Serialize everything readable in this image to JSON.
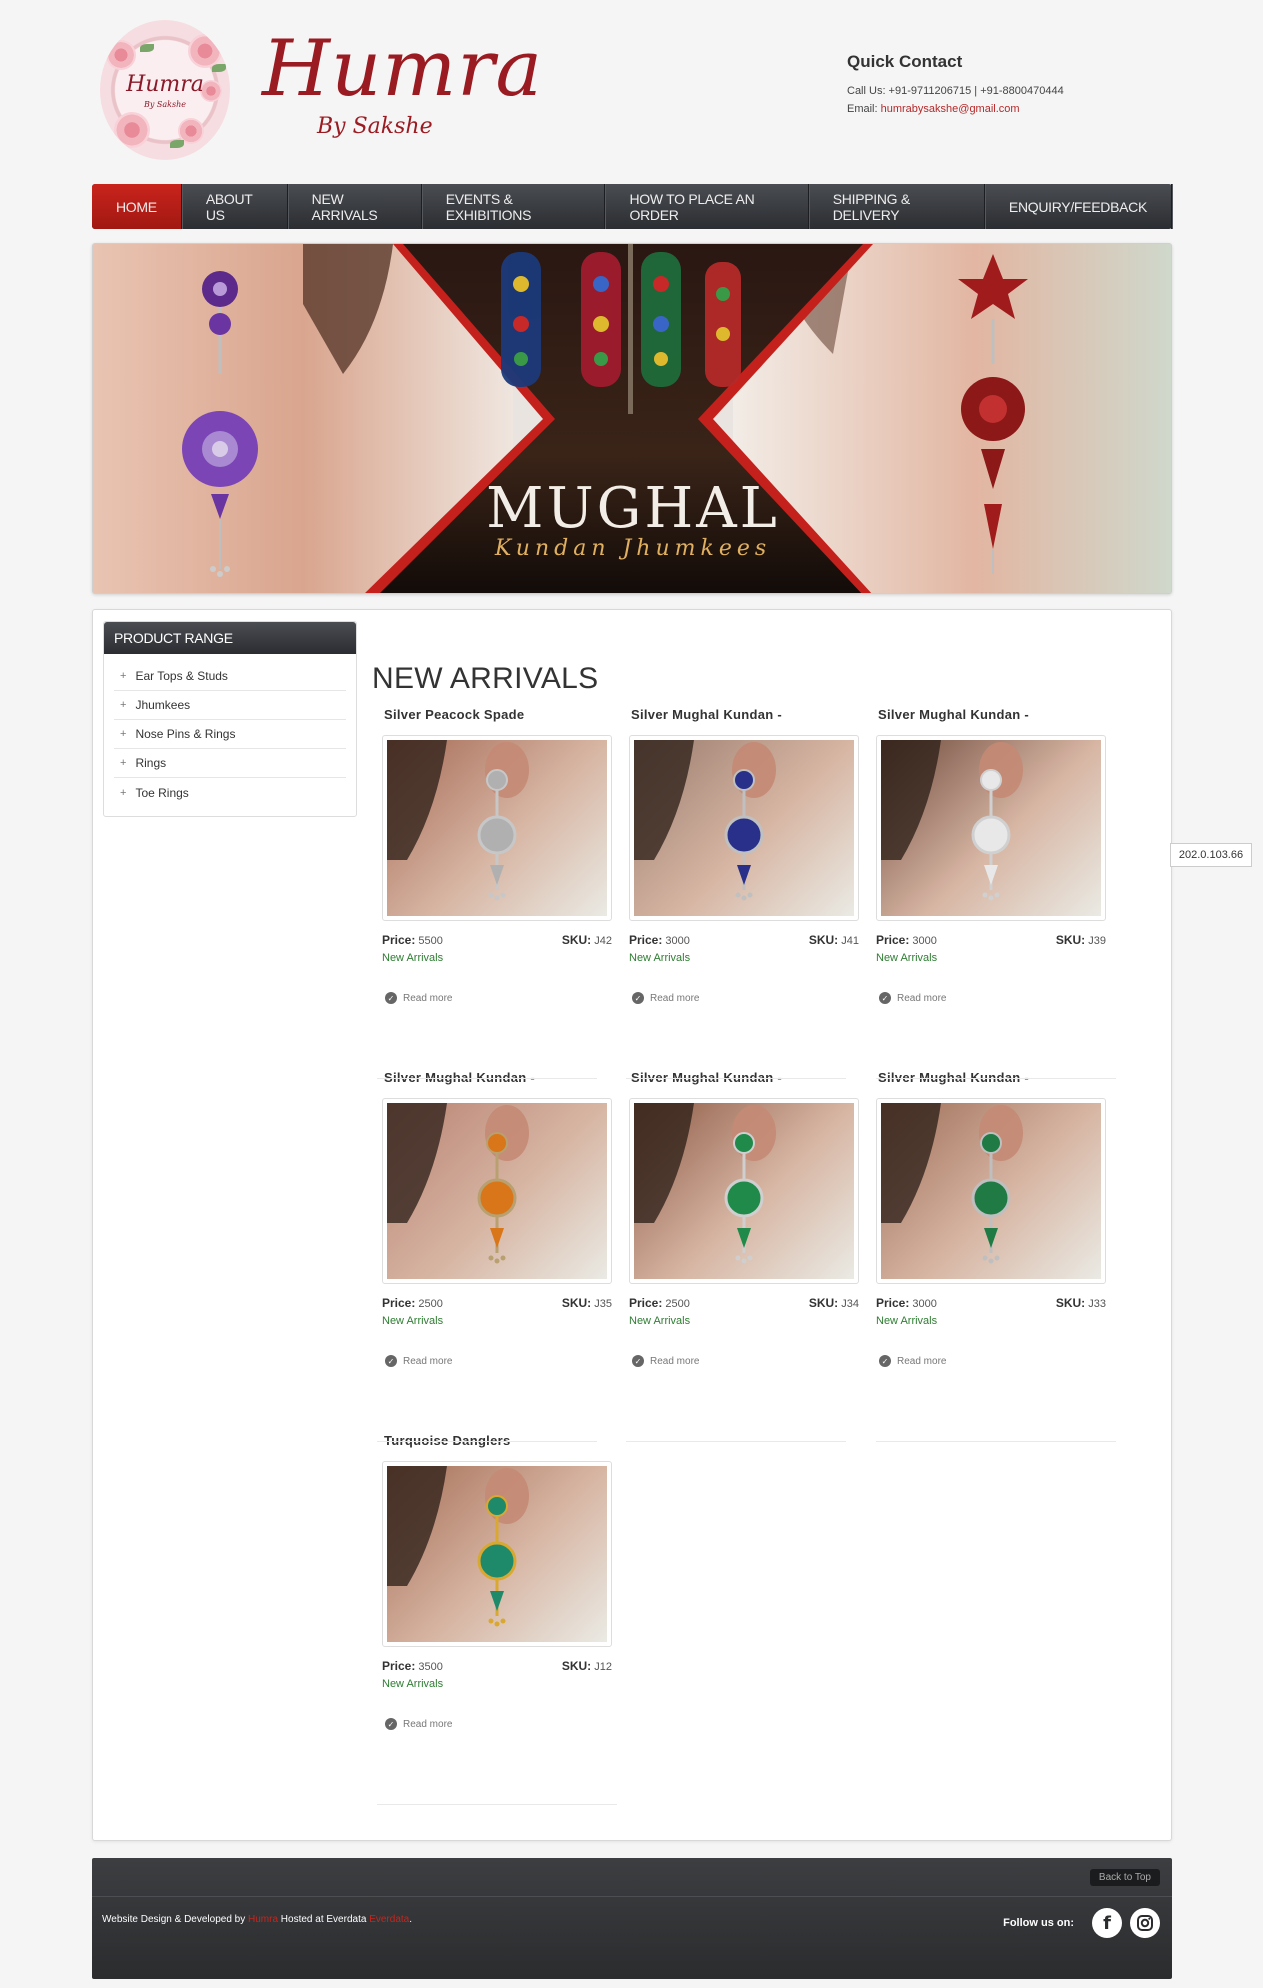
{
  "brand": {
    "logo_text": "Humra",
    "logo_sub": "By Sakshe",
    "name": "Humra",
    "tagline": "By Sakshe"
  },
  "quick_contact": {
    "title": "Quick Contact",
    "phone_line": "Call Us: +91-9711206715 | +91-8800470444",
    "email_label": "Email: ",
    "email": "humrabysakshe@gmail.com"
  },
  "nav": {
    "items": [
      {
        "label": "HOME",
        "active": true
      },
      {
        "label": "ABOUT US"
      },
      {
        "label": "NEW ARRIVALS"
      },
      {
        "label": "EVENTS & EXHIBITIONS"
      },
      {
        "label": "HOW TO PLACE AN ORDER"
      },
      {
        "label": "SHIPPING & DELIVERY"
      },
      {
        "label": "ENQUIRY/FEEDBACK"
      }
    ]
  },
  "banner": {
    "title": "MUGHAL",
    "subtitle": "Kundan Jhumkees"
  },
  "sidebar": {
    "title": "PRODUCT RANGE",
    "items": [
      "Ear Tops & Studs",
      "Jhumkees",
      "Nose Pins & Rings",
      "Rings",
      "Toe Rings"
    ]
  },
  "main": {
    "title": "NEW ARRIVALS",
    "price_label": "Price:",
    "sku_label": "SKU:",
    "read_more": "Read more",
    "products": [
      {
        "title": "Silver Peacock Spade",
        "price": "5500",
        "sku": "J42",
        "category": "New Arrivals"
      },
      {
        "title": "Silver Mughal Kundan -",
        "price": "3000",
        "sku": "J41",
        "category": "New Arrivals"
      },
      {
        "title": "Silver Mughal Kundan -",
        "price": "3000",
        "sku": "J39",
        "category": "New Arrivals"
      },
      {
        "title": "Silver Mughal Kundan -",
        "price": "2500",
        "sku": "J35",
        "category": "New Arrivals"
      },
      {
        "title": "Silver Mughal Kundan -",
        "price": "2500",
        "sku": "J34",
        "category": "New Arrivals"
      },
      {
        "title": "Silver Mughal Kundan -",
        "price": "3000",
        "sku": "J33",
        "category": "New Arrivals"
      },
      {
        "title": "Turquoise Danglers",
        "price": "3500",
        "sku": "J12",
        "category": "New Arrivals"
      }
    ]
  },
  "ip_tag": "202.0.103.66",
  "footer": {
    "back_to_top": "Back to Top",
    "credit_prefix": "Website Design & Developed by ",
    "credit_dev": "Humra",
    "credit_middle": " Hosted at Everdata ",
    "credit_host": "Everdata",
    "credit_suffix": ".",
    "follow_label": "Follow us on:",
    "social": [
      "facebook-icon",
      "instagram-icon"
    ]
  },
  "colors": {
    "brand_red": "#9b1b22",
    "nav_active": "#c9241c",
    "category_green": "#2e7d32"
  }
}
